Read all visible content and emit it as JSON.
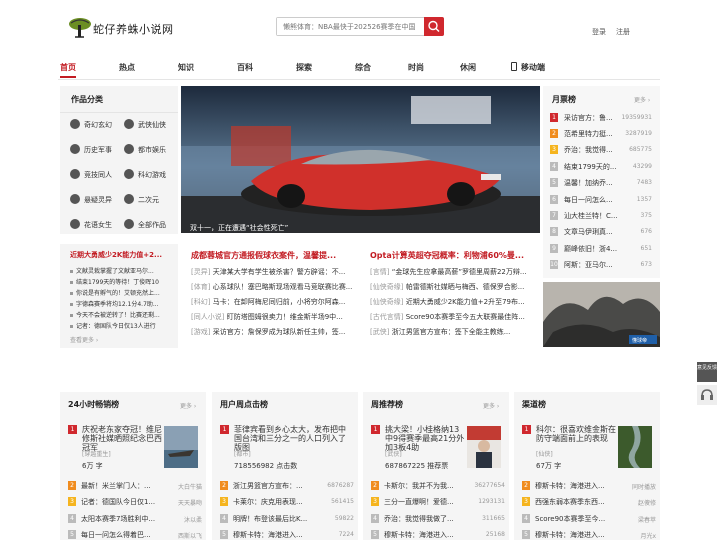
{
  "site": {
    "name": "蛇仔养蛛小说网",
    "search_placeholder": "懒熊体育：NBA最快于202526赛季在中国",
    "login": "登录",
    "register": "注册"
  },
  "nav": {
    "items": [
      "首页",
      "热点",
      "知识",
      "百科",
      "探索",
      "综合",
      "时尚",
      "休闲",
      "移动端"
    ],
    "active_index": 0
  },
  "categories": {
    "title": "作品分类",
    "items": [
      "奇幻玄幻",
      "武侠仙侠",
      "历史军事",
      "都市娱乐",
      "竞技同人",
      "科幻游戏",
      "悬疑灵异",
      "二次元",
      "花语女生",
      "全部作品"
    ],
    "icons": [
      "magic-icon",
      "sword-icon",
      "history-icon",
      "city-icon",
      "sports-icon",
      "game-icon",
      "mystery-icon",
      "anime-icon",
      "flower-icon",
      "grid-icon"
    ]
  },
  "carousel": {
    "caption": "双十一，正在遭遇“社会性死亡”",
    "image": "red-flying-car-photo"
  },
  "monthly_rank": {
    "title": "月票榜",
    "more": "更多 ›",
    "rows": [
      {
        "title": "采访官方：鲁...",
        "count": "19359931"
      },
      {
        "title": "范希里特力挺...",
        "count": "3287919"
      },
      {
        "title": "乔治：我觉得...",
        "count": "685775"
      },
      {
        "title": "结束1799天的...",
        "count": "43299"
      },
      {
        "title": "温馨！加纳乔...",
        "count": "7483"
      },
      {
        "title": "每日一问怎么...",
        "count": "1357"
      },
      {
        "title": "汕大桂兰特！C...",
        "count": "375"
      },
      {
        "title": "文章马伊琍真...",
        "count": "676"
      },
      {
        "title": "巅峰依旧！浙4...",
        "count": "651"
      },
      {
        "title": "阿斯：亚马尔...",
        "count": "673"
      }
    ]
  },
  "left_list": {
    "title": "近期大勇威少2K能力值+2...",
    "items": [
      "文献灵栽掌握了文献亚马尔...",
      "结束1799天的等待！丁俊晖10",
      "你说是有孵气的！艾顿充然上...",
      "字德森赛季将均12.1分4.7助...",
      "今天不会被逆转了！比赛还剩...",
      "记者：德国队今日仅13人进行"
    ],
    "more": "查看更多 ›"
  },
  "headlines": {
    "left_title": "成都蓉城官方通报假球衣案件，温馨提...",
    "right_title": "Opta计算英超夺冠概率：利物浦60%曼...",
    "left_items": [
      {
        "tag": "[灵异]",
        "text": "天津某大学有学生被杀害？警方辟谣：不..."
      },
      {
        "tag": "[体育]",
        "text": "心系球队！塞巴略斯现场观看马竞联赛比赛..."
      },
      {
        "tag": "[科幻]",
        "text": "马卡：在卸阿梅尼同归前，小将穷尔阿森..."
      },
      {
        "tag": "[同人小说]",
        "text": "盯防塔图姆很卖力！维金斯半场9中..."
      },
      {
        "tag": "[游戏]",
        "text": "采访官方：詹保罗成为球队新任主帅，签..."
      }
    ],
    "right_items": [
      {
        "tag": "[言情]",
        "text": "“金球先生应拿最高薪”罗德里周薪22万辩..."
      },
      {
        "tag": "[仙侠奇缘]",
        "text": "帕雷德斯社媒晒与梅西、德保罗合影..."
      },
      {
        "tag": "[仙侠奇缘]",
        "text": "近期大勇威少2K能力值+2升至79布..."
      },
      {
        "tag": "[古代言情]",
        "text": "Score90本赛季至今五大联赛最佳阵..."
      },
      {
        "tag": "[武侠]",
        "text": "浙江男篮官方宣布：签下全能主教练..."
      }
    ]
  },
  "right_image": {
    "alt": "dark-news-photo",
    "watermark": "懂球帝"
  },
  "boxes": [
    {
      "title": "24小时畅销榜",
      "more": "更多 ›",
      "top": {
        "title": "庆祝老东家夺冠！维尼修斯社媒晒照纪念巴西冠军",
        "tag": "[穿越重生]",
        "stat": "6万 字"
      },
      "thumb": "boat-photo",
      "rows": [
        {
          "title": "最新！米兰掌门人：...",
          "meta": "大白牛猫"
        },
        {
          "title": "记者：德国队今日仅1...",
          "meta": "天天暴吻"
        },
        {
          "title": "太阳本赛季7场胜利中...",
          "meta": "沐以柔"
        },
        {
          "title": "每日一问怎么得着巴...",
          "meta": "西斯以飞"
        }
      ]
    },
    {
      "title": "用户周点击榜",
      "more": "",
      "top": {
        "title": "菲律宾看到乡心太大，发布把中国台湾和三分之一的人口列入了版图",
        "tag": "[都市]",
        "stat": "718556982 点击数"
      },
      "thumb": "",
      "rows": [
        {
          "title": "浙江男篮官方宣布：...",
          "meta": "6876287"
        },
        {
          "title": "卡莱尔：庆克用表现...",
          "meta": "561415"
        },
        {
          "title": "明牌！布登该最后比K...",
          "meta": "59822"
        },
        {
          "title": "穆斯卡特：海港进入...",
          "meta": "7224"
        }
      ]
    },
    {
      "title": "周推荐榜",
      "more": "更多 ›",
      "top": {
        "title": "挑大梁！小桂格纳13中9得赛季最高21分外加3板4助",
        "tag": "[武侠]",
        "stat": "687867225 推荐票"
      },
      "thumb": "press-conference-photo",
      "rows": [
        {
          "title": "卡斯尔：我并不为我...",
          "meta": "36277654"
        },
        {
          "title": "三分一直爆啊！爱德...",
          "meta": "1293131"
        },
        {
          "title": "乔治：我觉得我做了...",
          "meta": "311665"
        },
        {
          "title": "穆斯卡特：海港进入...",
          "meta": "25168"
        }
      ]
    },
    {
      "title": "渠道榜",
      "more": "",
      "top": {
        "title": "科尔：很喜欢维金斯在防守端面前上的表现",
        "tag": "[仙侠]",
        "stat": "67万 字"
      },
      "thumb": "river-aerial-photo",
      "rows": [
        {
          "title": "穆斯卡特：海港进入...",
          "meta": "同时播放"
        },
        {
          "title": "西强东弱本赛季东西...",
          "meta": "赵傻修"
        },
        {
          "title": "Score90本赛季至今...",
          "meta": "梁春苹"
        },
        {
          "title": "穆斯卡特：海港进入...",
          "meta": "月光x"
        }
      ]
    }
  ],
  "floating": {
    "feedback": "意见反馈"
  },
  "colors": {
    "brand_red": "#c21b22",
    "rank1": "#d0282e",
    "rank2": "#f08c1e",
    "rank3": "#f5b41e"
  }
}
